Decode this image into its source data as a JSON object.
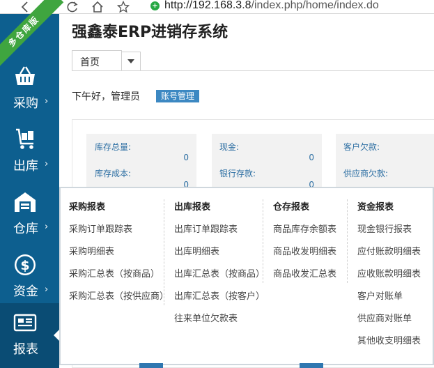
{
  "browser": {
    "url_host": "http://192.168.3.8",
    "url_path": "/index.php/home/index.do"
  },
  "ribbon": {
    "label": "多仓库版"
  },
  "sidebar": {
    "items": [
      {
        "label": "采购",
        "icon": "basket-icon",
        "arrow": "›"
      },
      {
        "label": "出库",
        "icon": "cart-icon",
        "arrow": "›"
      },
      {
        "label": "仓库",
        "icon": "warehouse-icon",
        "arrow": "›"
      },
      {
        "label": "资金",
        "icon": "dollar-coin-icon",
        "arrow": "›"
      },
      {
        "label": "报表",
        "icon": "report-icon",
        "active": true
      }
    ]
  },
  "header": {
    "app_title": "强鑫泰ERP进销存系统",
    "tab_home": "首页"
  },
  "greeting": {
    "text": "下午好，管理员",
    "account_button": "账号管理"
  },
  "stats": [
    {
      "label1": "库存总量:",
      "value1": "0",
      "label2": "库存成本:",
      "value2": "0"
    },
    {
      "label1": "现金:",
      "value1": "0",
      "label2": "银行存款:",
      "value2": "0"
    },
    {
      "label1": "客户欠款:",
      "value1": "",
      "label2": "供应商欠款:",
      "value2": ""
    }
  ],
  "report_menu": {
    "columns": [
      {
        "header": "采购报表",
        "items": [
          "采购订单跟踪表",
          "采购明细表",
          "采购汇总表（按商品）",
          "采购汇总表（按供应商）"
        ]
      },
      {
        "header": "出库报表",
        "items": [
          "出库订单跟踪表",
          "出库明细表",
          "出库汇总表（按商品）",
          "出库汇总表（按客户）",
          "往来单位欠款表"
        ]
      },
      {
        "header": "仓存报表",
        "items": [
          "商品库存余额表",
          "商品收发明细表",
          "商品收发汇总表"
        ]
      },
      {
        "header": "资金报表",
        "items": [
          "现金银行报表",
          "应付账款明细表",
          "应收账款明细表",
          "客户对账单",
          "供应商对账单",
          "其他收支明细表"
        ]
      }
    ]
  },
  "colors": {
    "sidebar": "#0d5f8f",
    "sidebar_active": "#0a4c74",
    "ribbon": "#3fa53f",
    "accent_button": "#3c88c2",
    "stat_text": "#2d6fa3"
  }
}
